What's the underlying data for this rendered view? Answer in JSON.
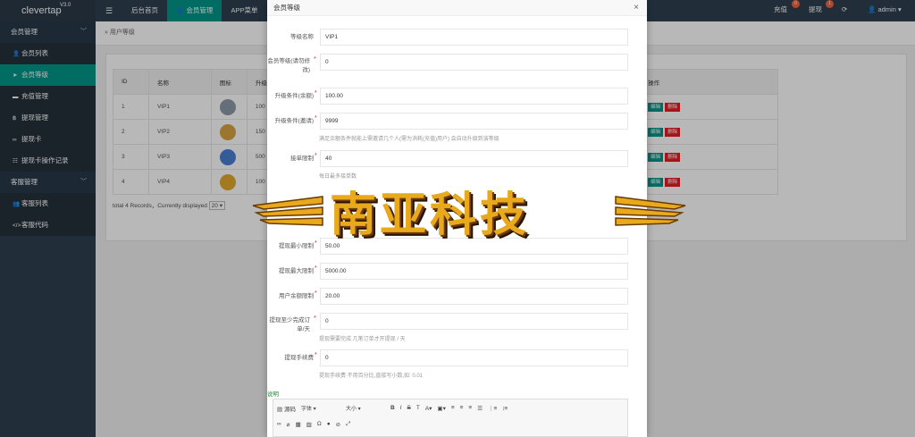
{
  "app": {
    "name": "clevertap",
    "version": "V3.0"
  },
  "topnav": {
    "items": [
      "后台首页",
      "会员管理",
      "APP菜单"
    ],
    "active": 1
  },
  "topright": {
    "recharge": "充值",
    "recharge_count": "0",
    "withdraw": "提现",
    "withdraw_count": "1",
    "user": "admin"
  },
  "sidebar": {
    "group1": "会员管理",
    "items1": [
      {
        "label": "会员列表",
        "icon": "user-icon"
      },
      {
        "label": "会员等级",
        "icon": "send-icon",
        "active": true
      },
      {
        "label": "充值管理",
        "icon": "chat-icon"
      },
      {
        "label": "提现管理",
        "icon": "bitcoin-icon"
      },
      {
        "label": "提现卡",
        "icon": "link-icon"
      },
      {
        "label": "提现卡操作记录",
        "icon": "list-icon"
      }
    ],
    "group2": "客服管理",
    "items2": [
      {
        "label": "客服列表",
        "icon": "users-icon"
      },
      {
        "label": "客服代码",
        "icon": "code-icon"
      }
    ]
  },
  "breadcrumb": "用户等级",
  "table": {
    "headers": [
      "ID",
      "名称",
      "图标",
      "升级",
      "操作"
    ],
    "rows": [
      {
        "id": "1",
        "name": "VIP1",
        "upgrade": "100",
        "medal_color": "#8c9aa8"
      },
      {
        "id": "2",
        "name": "VIP2",
        "upgrade": "150",
        "medal_color": "#d9a441"
      },
      {
        "id": "3",
        "name": "VIP3",
        "upgrade": "500",
        "medal_color": "#4a7fd4"
      },
      {
        "id": "4",
        "name": "VIP4",
        "upgrade": "100",
        "medal_color": "#e0a92e"
      }
    ],
    "edit_label": "编辑",
    "delete_label": "删除",
    "footer_text": "total 4 Records，Currently displayed",
    "page_size": "20"
  },
  "modal": {
    "title": "会员等级",
    "fields": {
      "name": {
        "label": "等级名称",
        "value": "VIP1"
      },
      "level": {
        "label": "会员等级(请勿修改)",
        "value": "0"
      },
      "upgrade_balance": {
        "label": "升级条件(余额)",
        "value": "100.00"
      },
      "upgrade_invite": {
        "label": "升级条件(邀请)",
        "value": "9999",
        "help": "满足余额条件就能上需邀请几个人(需为消耗(充值)用户) 会自动升级到该等级"
      },
      "daily_orders": {
        "label": "接单限制",
        "value": "40",
        "help": "每日最多接单数"
      },
      "withdraw_min": {
        "label": "提现最小限制",
        "value": "50.00"
      },
      "withdraw_max": {
        "label": "提现最大限制",
        "value": "5000.00"
      },
      "balance_limit": {
        "label": "用户余额限制",
        "value": "20.00"
      },
      "min_orders": {
        "label": "提现至少完成订单/天",
        "value": "0",
        "help": "提现需要完成 几笔订单才开提现 / 天"
      },
      "fee": {
        "label": "提现手续费",
        "value": "0",
        "help": "提现手续费 不用百分比,直接写小数,如: 0.01"
      }
    },
    "desc_label": "说明",
    "editor": {
      "source": "源码",
      "font": "字体",
      "size": "大小"
    }
  },
  "watermark": {
    "text": "南亚科技"
  }
}
